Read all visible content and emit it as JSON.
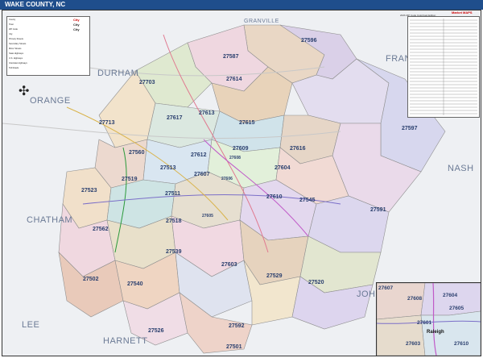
{
  "header": {
    "title": "WAKE COUNTY, NC"
  },
  "edition": "2026 ZIP Code ColorCast Edition",
  "logo": "Market MAPS",
  "legend": {
    "rows": [
      "County",
      "Town",
      "ZIP Code",
      "City",
      "Primary Streets",
      "Secondary Streets",
      "Minor Streets",
      "State Highways",
      "U.S. Highways",
      "Interstate Highways",
      "Toll Roads"
    ],
    "cities": [
      "City",
      "City",
      "City"
    ]
  },
  "counties": [
    {
      "name": "DURHAM"
    },
    {
      "name": "ORANGE"
    },
    {
      "name": "FRANKLIN"
    },
    {
      "name": "NASH"
    },
    {
      "name": "CHATHAM"
    },
    {
      "name": "JOHNSTON"
    },
    {
      "name": "LEE"
    },
    {
      "name": "HARNETT"
    },
    {
      "name": "GRANVILLE"
    }
  ],
  "zips": [
    {
      "code": "27596"
    },
    {
      "code": "27587"
    },
    {
      "code": "27703"
    },
    {
      "code": "27614"
    },
    {
      "code": "27713"
    },
    {
      "code": "27617"
    },
    {
      "code": "27613"
    },
    {
      "code": "27615"
    },
    {
      "code": "27597"
    },
    {
      "code": "27560"
    },
    {
      "code": "27612"
    },
    {
      "code": "27609"
    },
    {
      "code": "27616"
    },
    {
      "code": "27519"
    },
    {
      "code": "27513"
    },
    {
      "code": "27607"
    },
    {
      "code": "27604"
    },
    {
      "code": "27523"
    },
    {
      "code": "27511"
    },
    {
      "code": "27610"
    },
    {
      "code": "27545"
    },
    {
      "code": "27591"
    },
    {
      "code": "27518"
    },
    {
      "code": "27562"
    },
    {
      "code": "27539"
    },
    {
      "code": "27603"
    },
    {
      "code": "27529"
    },
    {
      "code": "27520"
    },
    {
      "code": "27540"
    },
    {
      "code": "27592"
    },
    {
      "code": "27526"
    },
    {
      "code": "27501"
    },
    {
      "code": "27608"
    },
    {
      "code": "27606"
    },
    {
      "code": "27502"
    },
    {
      "code": "27605"
    }
  ],
  "inset": {
    "zips": [
      {
        "code": "27607"
      },
      {
        "code": "27608"
      },
      {
        "code": "27604"
      },
      {
        "code": "27605"
      },
      {
        "code": "27601"
      },
      {
        "code": "27603"
      },
      {
        "code": "27610"
      }
    ],
    "city": "Raleigh"
  },
  "colors": {
    "header": "#1f4e8c",
    "accent": "#2a3f6e"
  }
}
